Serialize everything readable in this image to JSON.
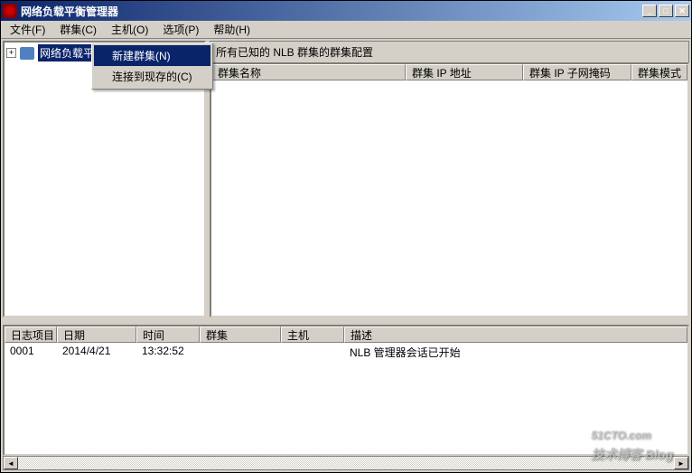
{
  "window": {
    "title": "网络负载平衡管理器"
  },
  "menubar": {
    "file": "文件(F)",
    "cluster": "群集(C)",
    "host": "主机(O)",
    "options": "选项(P)",
    "help": "帮助(H)"
  },
  "tree": {
    "root": "网络负载平衡群集"
  },
  "context_menu": {
    "new_cluster": "新建群集(N)",
    "connect_existing": "连接到现存的(C)"
  },
  "right_pane": {
    "header": "所有已知的 NLB 群集的群集配置",
    "columns": {
      "name": "群集名称",
      "ip": "群集 IP 地址",
      "subnet": "群集 IP 子网掩码",
      "mode": "群集模式"
    }
  },
  "log": {
    "columns": {
      "entry": "日志项目",
      "date": "日期",
      "time": "时间",
      "cluster": "群集",
      "host": "主机",
      "description": "描述"
    },
    "row1": {
      "entry": "0001",
      "date": "2014/4/21",
      "time": "13:32:52",
      "cluster": "",
      "host": "",
      "description": "NLB 管理器会话已开始"
    }
  },
  "watermark": {
    "main": "51CTO.com",
    "sub": "技术博客 Blog"
  }
}
